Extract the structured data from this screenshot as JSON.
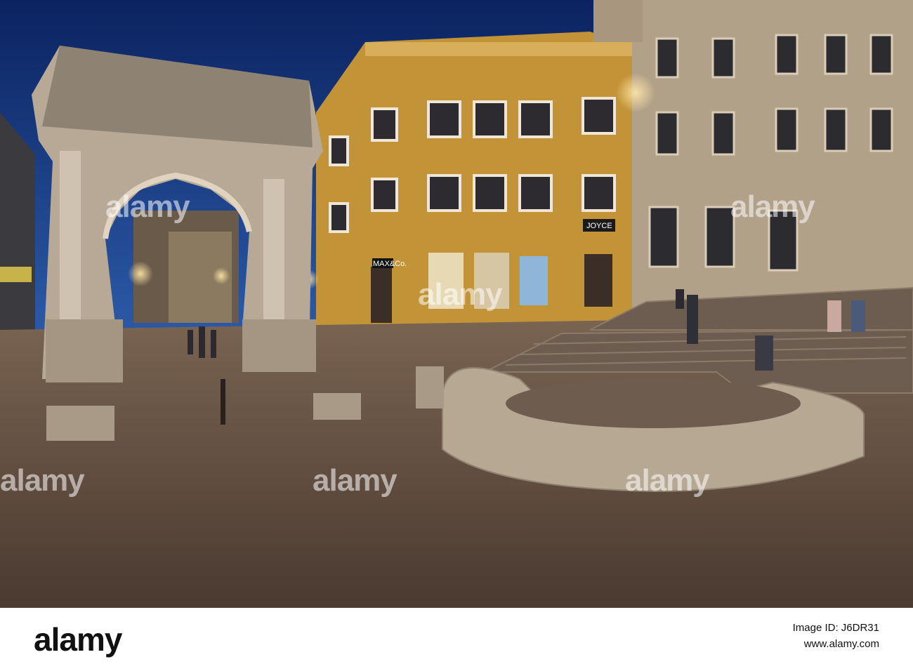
{
  "scene": {
    "signs": {
      "shop_left": "MAX&Co.",
      "shop_right": "JOYCE"
    },
    "colors": {
      "sky": "#0f2a66",
      "facade_yellow": "#c79a3c",
      "facade_beige": "#b8a58a",
      "pavement": "#5e4a3a",
      "stone": "#cdbfae"
    }
  },
  "watermark": {
    "text": "alamy"
  },
  "footer": {
    "logo": "alamy",
    "image_id_line": "Image ID: J6DR31",
    "url_line": "www.alamy.com"
  }
}
